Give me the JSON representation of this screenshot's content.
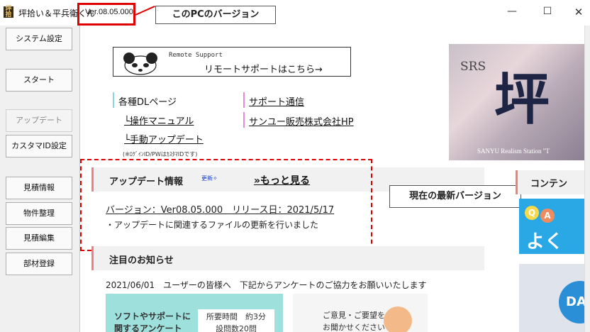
{
  "window": {
    "title": "坪拾い＆平兵衛くん",
    "icon_text": "坪拾",
    "version": "Ver.08.05.000",
    "minimize_label": "—",
    "maximize_label": "☐",
    "close_label": "✕"
  },
  "annotations": {
    "pc_version": "このPCのバージョン",
    "latest_version": "現在の最新バージョン"
  },
  "sidebar": {
    "items": [
      {
        "label": "システム設定"
      },
      {
        "label": "スタート"
      },
      {
        "label": "アップデート"
      },
      {
        "label": "カスタマID設定"
      },
      {
        "label": "見積情報"
      },
      {
        "label": "物件整理"
      },
      {
        "label": "見積編集"
      },
      {
        "label": "部材登録"
      }
    ]
  },
  "remote": {
    "small": "Remote Support",
    "main": "リモートサポートはこちら→"
  },
  "links": {
    "dl_page": "各種DLページ",
    "manual": "└操作マニュアル",
    "manual_update": "└手動アップデート",
    "support_news": "サポート通信",
    "company_hp": "サンユー販売株式会社HP",
    "login_note": "(※ﾛｸﾞｲﾝID/PWはｶｽﾀﾏIDです)"
  },
  "srs": {
    "label": "SRS",
    "kanji": "坪",
    "sub": "SANYU Realism Station \"T"
  },
  "update_section": {
    "title": "アップデート情報",
    "badge": "更新✧",
    "more": "»もっと見る",
    "version_line": "バージョン：Ver08.05.000　リリース日：2021/5/17",
    "description": "・アップデートに関連するファイルの更新を行いました"
  },
  "notice_section": {
    "title": "注目のお知らせ",
    "item": "2021/06/01　ユーザーの皆様へ　下記からアンケートのご協力をお願いいたします"
  },
  "banners": {
    "survey_line1": "ソフトやサポートに",
    "survey_line2": "関するアンケート",
    "time_line1": "所要時間　約3分",
    "time_line2": "設問数20問",
    "opinion_line1": "ご意見・ご要望を",
    "opinion_line2": "お聞かせください"
  },
  "right_column": {
    "content_title": "コンテン",
    "qa_q": "Q",
    "qa_a": "A",
    "qa_text": "よく",
    "da_text": "DA"
  }
}
